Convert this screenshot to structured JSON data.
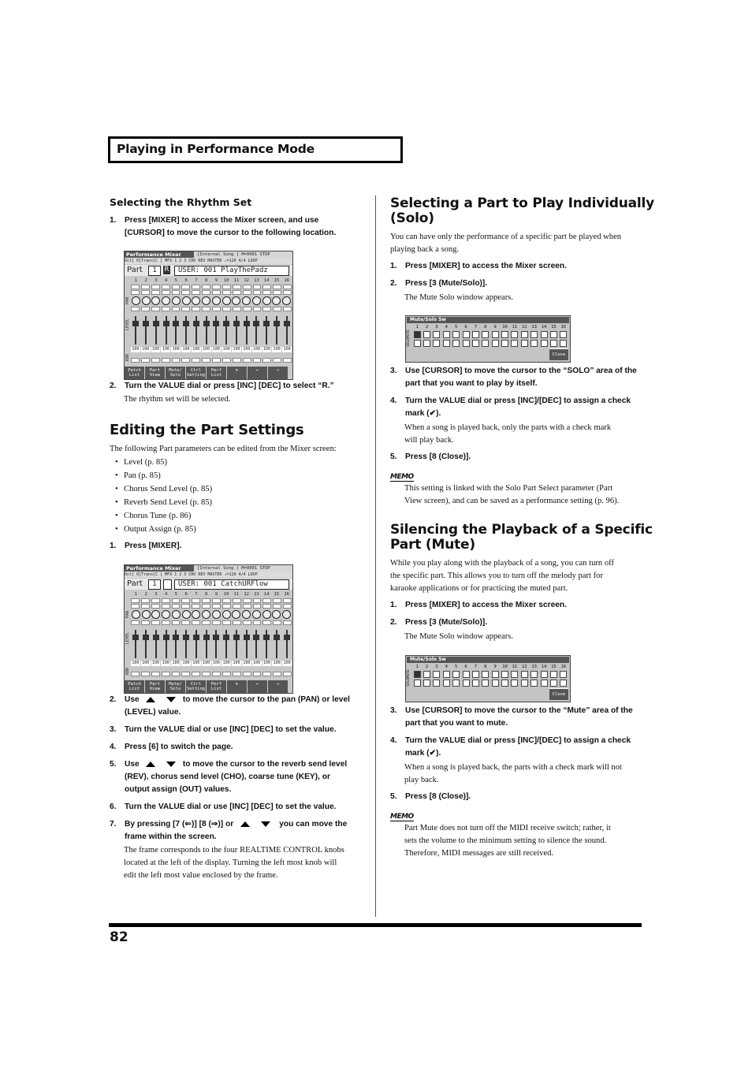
{
  "chapter_title": "Playing in Performance Mode",
  "page_number": "82",
  "left": {
    "rhythm": {
      "heading": "Selecting the Rhythm Set",
      "steps": [
        {
          "num": "1.",
          "text": "Press [MIXER] to access the Mixer screen, and use",
          "text2": "[CURSOR] to move the cursor to the following location."
        },
        {
          "num": "2.",
          "text": "Turn the VALUE dial or press [INC] [DEC] to select “R.”",
          "body": "The rhythm set will be selected."
        }
      ]
    },
    "editing": {
      "heading": "Editing the Part Settings",
      "intro": "The following Part parameters can be edited from the Mixer screen:",
      "bullets": [
        "Level (p. 85)",
        "Pan (p. 85)",
        "Chorus Send Level (p. 85)",
        "Reverb Send Level (p. 85)",
        "Chorus Tune (p. 86)",
        "Output Assign (p. 85)"
      ],
      "step1": {
        "num": "1.",
        "text": "Press [MIXER]."
      },
      "step2": {
        "num": "2.",
        "pre": "Use",
        "post": "to move the cursor to the pan (PAN) or level",
        "line2": "(LEVEL) value."
      },
      "step3": {
        "num": "3.",
        "text": "Turn the VALUE dial or use [INC] [DEC] to set the value."
      },
      "step4": {
        "num": "4.",
        "text": "Press [6] to switch the page."
      },
      "step5": {
        "num": "5.",
        "pre": "Use",
        "post": "to move the cursor to the reverb send level",
        "line2": "(REV), chorus send level (CHO), coarse tune (KEY), or",
        "line3": "output assign (OUT) values."
      },
      "step6": {
        "num": "6.",
        "text": "Turn the VALUE dial or use [INC] [DEC] to set the value."
      },
      "step7": {
        "num": "7.",
        "pre": "By pressing [7 (⇐)] [8 (⇒)] or",
        "post": "you can move the",
        "line2": "frame within the screen.",
        "body": [
          "The frame corresponds to the four REALTIME CONTROL knobs",
          "located at the left of the display. Turning the left most knob will",
          "edit the left most value enclosed by the frame."
        ]
      }
    }
  },
  "right": {
    "solo": {
      "heading_l1": "Selecting a Part to Play Individually",
      "heading_l2": "(Solo)",
      "intro": [
        "You can have only the performance of a specific part be played when",
        "playing back a song."
      ],
      "step1": {
        "num": "1.",
        "text": "Press [MIXER] to access the Mixer screen."
      },
      "step2": {
        "num": "2.",
        "text": "Press [3 (Mute/Solo)].",
        "body": "The Mute Solo window appears."
      },
      "step3": {
        "num": "3.",
        "text": "Use [CURSOR] to move the cursor to the “SOLO” area of the",
        "line2": "part that you want to play by itself."
      },
      "step4": {
        "num": "4.",
        "text": "Turn the VALUE dial or press [INC]/[DEC] to assign a check",
        "line2": "mark (✔).",
        "body": [
          "When a song is played back, only the parts with a check mark",
          "will play back."
        ]
      },
      "step5": {
        "num": "5.",
        "text": "Press [8 (Close)]."
      },
      "memo_label": "MEMO",
      "memo": [
        "This setting is linked with the Solo Part Select parameter (Part",
        "View screen), and can be saved as a performance setting (p. 96)."
      ]
    },
    "mute": {
      "heading_l1": "Silencing the Playback of a Specific",
      "heading_l2": "Part (Mute)",
      "intro": [
        "While you play along with the playback of a song, you can turn off",
        "the specific part. This allows you to turn off the melody part for",
        "karaoke applications or for practicing the muted part."
      ],
      "step1": {
        "num": "1.",
        "text": "Press [MIXER] to access the Mixer screen."
      },
      "step2": {
        "num": "2.",
        "text": "Press [3 (Mute/Solo)].",
        "body": "The Mute Solo window appears."
      },
      "step3": {
        "num": "3.",
        "text": "Use [CURSOR] to move the cursor to the “Mute” area of the",
        "line2": "part that you want to mute."
      },
      "step4": {
        "num": "4.",
        "text": "Turn the VALUE dial or press [INC]/[DEC] to assign a check",
        "line2": "mark (✔).",
        "body": [
          "When a song is played back, the parts with a check mark will not",
          "play back."
        ]
      },
      "step5": {
        "num": "5.",
        "text": "Press [8 (Close)]."
      },
      "memo_label": "MEMO",
      "memo": [
        "Part Mute does not turn off the MIDI receive switch; rather, it",
        "sets the volume to the minimum setting to silence the sound.",
        "Therefore, MIDI messages are still received."
      ]
    }
  },
  "mixer1": {
    "title": "Performance Mixer",
    "song": "[Internal Song  ] M=0001  STOP",
    "row2": "Oct[ 0]Trans[C ] MFX 1 2 3 CHO REV MASTER  ♩=120   4/4 LOOP",
    "part_label": "Part",
    "part_num": "1",
    "part_type": "R",
    "patch": "USER: 001  PlayThePadz",
    "parts": [
      "1",
      "2",
      "3",
      "4",
      "5",
      "6",
      "7",
      "8",
      "9",
      "10",
      "11",
      "12",
      "13",
      "14",
      "15",
      "16"
    ],
    "levels": [
      "100",
      "100",
      "100",
      "100",
      "100",
      "100",
      "100",
      "100",
      "100",
      "100",
      "100",
      "100",
      "100",
      "100",
      "100",
      "100"
    ],
    "side_pan": "PAN",
    "side_level": "LEVEL",
    "side_kbd": "KBD",
    "buttons": [
      "Patch List",
      "Part View",
      "Mute/ Solo",
      "Ctrl Setting",
      "Perf List",
      "⇱",
      "⇐",
      "⇒"
    ],
    "ctrl_knob": "Ctrl Knob"
  },
  "mixer2": {
    "title": "Performance Mixer",
    "song": "[Internal Song  ] M=0001  STOP",
    "row2": "Oct[ 0]Trans[C ] MFX 1 2 3 CHO REV MASTER  ♩=120   4/4 LOOP",
    "part_label": "Part",
    "part_num": "1",
    "part_type": "",
    "patch": "USER: 001  CatchURFlow",
    "parts": [
      "1",
      "2",
      "3",
      "4",
      "5",
      "6",
      "7",
      "8",
      "9",
      "10",
      "11",
      "12",
      "13",
      "14",
      "15",
      "16"
    ],
    "levels": [
      "100",
      "100",
      "100",
      "100",
      "100",
      "100",
      "100",
      "100",
      "100",
      "100",
      "100",
      "100",
      "100",
      "100",
      "100",
      "100"
    ],
    "side_pan": "PAN",
    "side_level": "LEVEL",
    "side_kbd": "KBD",
    "buttons": [
      "Patch List",
      "Part View",
      "Mute/ Solo",
      "Ctrl Setting",
      "Perf List",
      "⇱",
      "⇐",
      "⇒"
    ],
    "ctrl_knob": "Ctrl Knob"
  },
  "mutesolo": {
    "title": "Mute/Solo Sw",
    "parts": [
      "1",
      "2",
      "3",
      "4",
      "5",
      "6",
      "7",
      "8",
      "9",
      "10",
      "11",
      "12",
      "13",
      "14",
      "15",
      "16"
    ],
    "mute_label": "MUTE",
    "solo_label": "SOLO",
    "close_label": "Close",
    "cursor_part": 1
  }
}
